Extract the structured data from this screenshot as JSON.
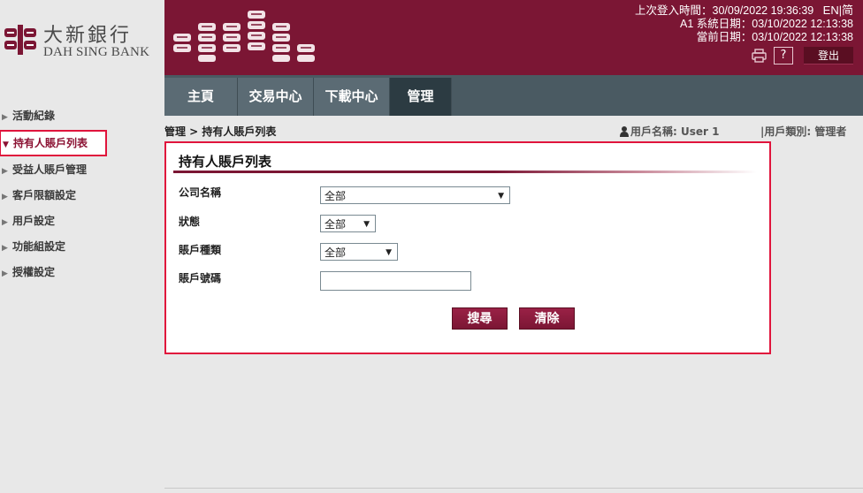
{
  "brand": {
    "name_cn": "大新銀行",
    "name_en": "DAH SING BANK"
  },
  "header": {
    "last_login_label": "上次登入時間：",
    "last_login_value": "30/09/2022 19:36:39",
    "lang_en": "EN",
    "lang_sep": "|",
    "lang_sc": "简",
    "system_date_label": "A1 系統日期：",
    "system_date_value": "03/10/2022 12:13:38",
    "current_date_label": "當前日期：",
    "current_date_value": "03/10/2022 12:13:38",
    "help_label": "?",
    "logout_label": "登出"
  },
  "topnav": {
    "tabs": [
      {
        "label": "主頁"
      },
      {
        "label": "交易中心"
      },
      {
        "label": "下載中心"
      },
      {
        "label": "管理",
        "active": true
      }
    ]
  },
  "sidebar": {
    "items": [
      {
        "label": "活動紀錄"
      },
      {
        "label": "持有人賬戶列表",
        "active": true
      },
      {
        "label": "受益人賬戶管理"
      },
      {
        "label": "客戶限額設定"
      },
      {
        "label": "用戶設定"
      },
      {
        "label": "功能組設定"
      },
      {
        "label": "授權設定"
      }
    ]
  },
  "breadcrumb": "管理 > 持有人賬戶列表",
  "user": {
    "name_label": "用戶名稱:",
    "name_value": "User 1",
    "role_text": "|用戶類別: 管理者"
  },
  "panel": {
    "title": "持有人賬戶列表",
    "company_label": "公司名稱",
    "company_value": "全部",
    "status_label": "狀態",
    "status_value": "全部",
    "account_type_label": "賬戶種類",
    "account_type_value": "全部",
    "account_no_label": "賬戶號碼",
    "account_no_value": "",
    "search_button": "搜尋",
    "clear_button": "清除"
  },
  "colors": {
    "brand": "#7b1634",
    "nav_bg": "#4a5a62",
    "highlight": "#e0143c"
  }
}
